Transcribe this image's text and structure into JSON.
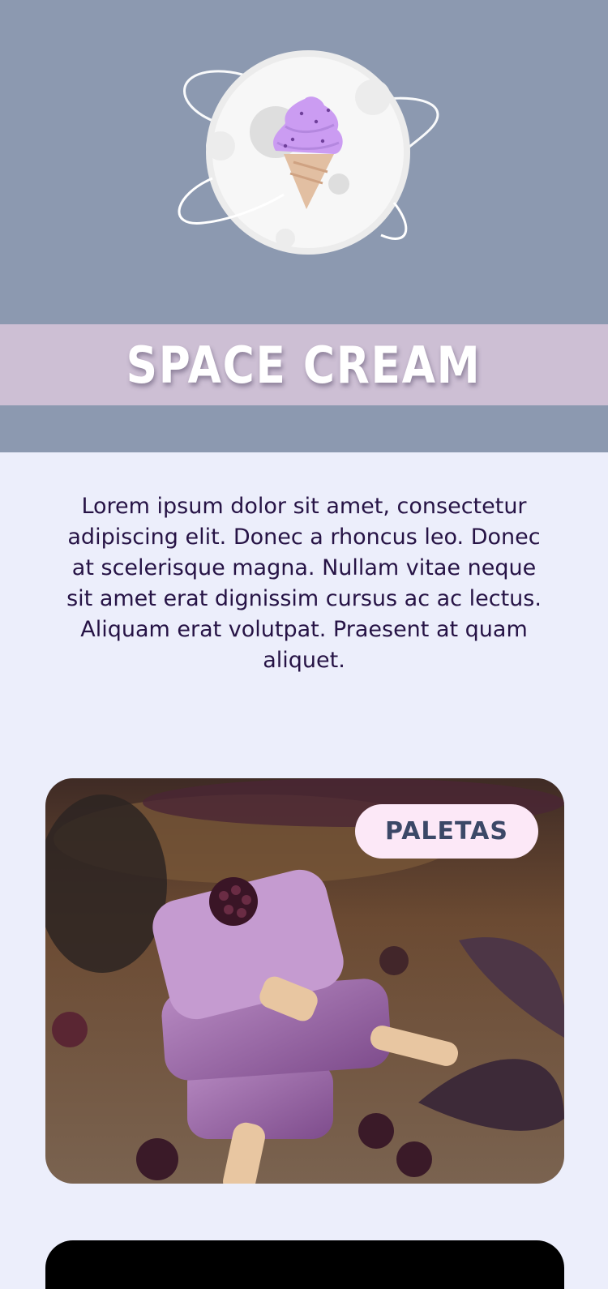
{
  "brand": {
    "name": "SPACE CREAM",
    "logo_icon": "ice-cream-planet-icon"
  },
  "intro": {
    "text": "Lorem ipsum dolor sit amet, consectetur adipiscing elit. Donec a rhoncus leo. Donec at scelerisque magna. Nullam vitae neque sit amet erat dignissim cursus ac ac lectus. Aliquam erat volutpat. Praesent at quam aliquet."
  },
  "categories": [
    {
      "label": "PALETAS"
    }
  ],
  "colors": {
    "hero_bg": "#8c99b0",
    "title_band": "#cdbfd4",
    "page_bg": "#eceefb",
    "text": "#261345",
    "badge_bg": "#fce8f7",
    "badge_text": "#3b4867"
  }
}
